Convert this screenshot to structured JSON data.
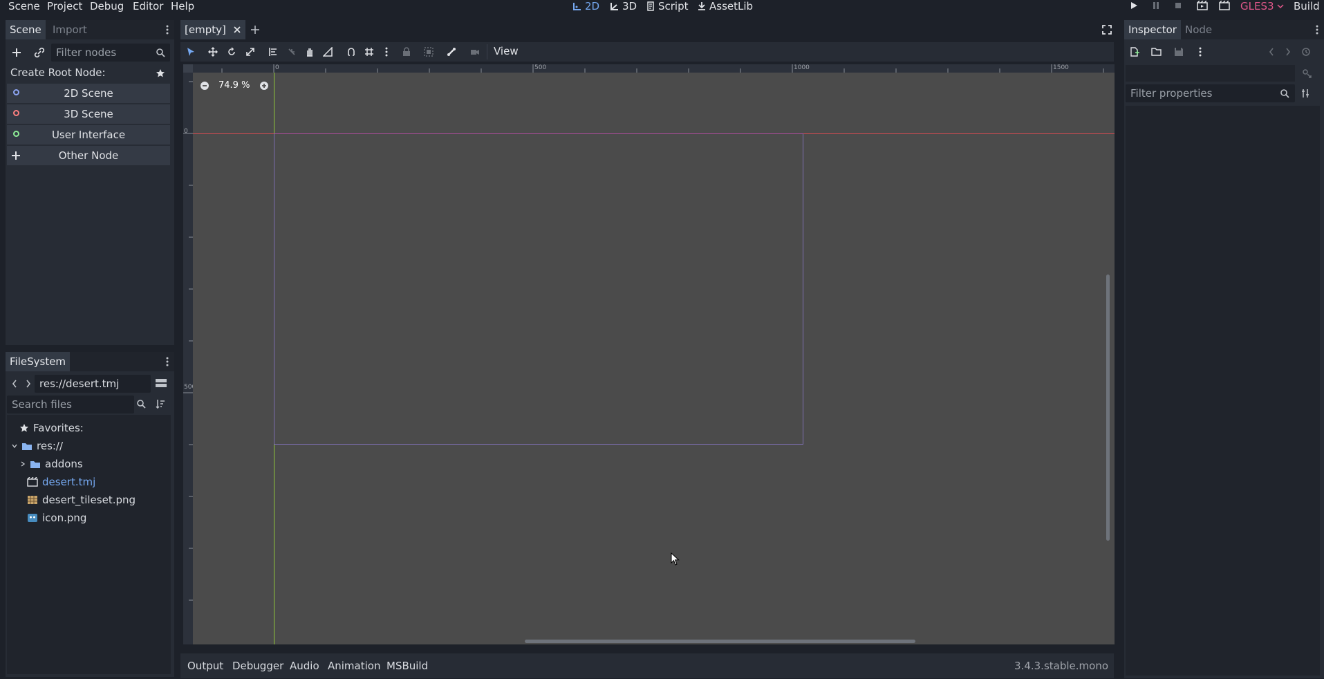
{
  "menubar": {
    "items": [
      "Scene",
      "Project",
      "Debug",
      "Editor",
      "Help"
    ],
    "modes": [
      {
        "label": "2D",
        "icon": "2d-icon",
        "active": true
      },
      {
        "label": "3D",
        "icon": "3d-icon",
        "active": false
      },
      {
        "label": "Script",
        "icon": "script-icon",
        "active": false
      },
      {
        "label": "AssetLib",
        "icon": "assetlib-icon",
        "active": false
      }
    ],
    "renderer": "GLES3",
    "build_label": "Build"
  },
  "scene_dock": {
    "tabs": [
      "Scene",
      "Import"
    ],
    "filter_placeholder": "Filter nodes",
    "create_root_label": "Create Root Node:",
    "root_buttons": [
      {
        "label": "2D Scene",
        "color": "#8da5f3"
      },
      {
        "label": "3D Scene",
        "color": "#fc7f7f"
      },
      {
        "label": "User Interface",
        "color": "#8eef97"
      },
      {
        "label": "Other Node",
        "color": "#e0e0e0"
      }
    ]
  },
  "filesystem": {
    "tab": "FileSystem",
    "path": "res://desert.tmj",
    "search_placeholder": "Search files",
    "favorites_label": "Favorites:",
    "root": "res://",
    "items": [
      {
        "label": "addons",
        "type": "folder"
      },
      {
        "label": "desert.tmj",
        "type": "scene",
        "selected": true
      },
      {
        "label": "desert_tileset.png",
        "type": "image"
      },
      {
        "label": "icon.png",
        "type": "image"
      }
    ]
  },
  "editor": {
    "tab_label": "[empty]",
    "view_menu": "View",
    "zoom": "74.9 %",
    "ruler_h_labels": [
      "0",
      "500",
      "1000",
      "1500"
    ],
    "ruler_v_labels": [
      "0",
      "500"
    ]
  },
  "inspector": {
    "tabs": [
      "Inspector",
      "Node"
    ],
    "filter_placeholder": "Filter properties"
  },
  "bottom_panel": {
    "tabs": [
      "Output",
      "Debugger",
      "Audio",
      "Animation",
      "MSBuild"
    ],
    "version": "3.4.3.stable.mono"
  }
}
